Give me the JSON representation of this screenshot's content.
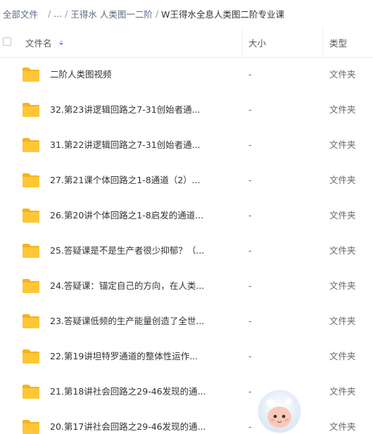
{
  "breadcrumb": {
    "root": "全部文件",
    "ellipsis": "...",
    "level2": "王得水 人类图一二阶",
    "current": "W王得水全息人类图二阶专业课",
    "separator": "/"
  },
  "table": {
    "columns": {
      "name": "文件名",
      "size": "大小",
      "type": "类型"
    },
    "rows": [
      {
        "name": "二阶人类图视频",
        "size": "-",
        "type": "文件夹",
        "icon": "folder-icon"
      },
      {
        "name": "32.第23讲逻辑回路之7-31创始者通...",
        "size": "-",
        "type": "文件夹",
        "icon": "folder-icon"
      },
      {
        "name": "31.第22讲逻辑回路之7-31创始者通...",
        "size": "-",
        "type": "文件夹",
        "icon": "folder-icon"
      },
      {
        "name": "27.第21课个体回路之1-8通道（2）...",
        "size": "-",
        "type": "文件夹",
        "icon": "folder-icon"
      },
      {
        "name": "26.第20讲个体回路之1-8启发的通道...",
        "size": "-",
        "type": "文件夹",
        "icon": "folder-icon"
      },
      {
        "name": "25.答疑课是不是生产者很少抑郁？（...",
        "size": "-",
        "type": "文件夹",
        "icon": "folder-icon"
      },
      {
        "name": "24.答疑课：锚定自己的方向，在人类...",
        "size": "-",
        "type": "文件夹",
        "icon": "folder-icon"
      },
      {
        "name": "23.答疑课低频的生产能量创造了全世...",
        "size": "-",
        "type": "文件夹",
        "icon": "folder-icon"
      },
      {
        "name": "22.第19讲坦特罗通道的整体性运作...",
        "size": "-",
        "type": "文件夹",
        "icon": "folder-icon"
      },
      {
        "name": "21.第18讲社会回路之29-46发现的通...",
        "size": "-",
        "type": "文件夹",
        "icon": "folder-icon"
      },
      {
        "name": "20.第17讲社会回路之29-46发现的通...",
        "size": "-",
        "type": "文件夹",
        "icon": "folder-icon"
      }
    ]
  },
  "colors": {
    "folder": "#ffc735",
    "link": "#5a6b85",
    "sort_active": "#3b8cff",
    "text": "#333333",
    "muted": "#666666"
  },
  "assistant": {
    "icon": "mascot-assistant-icon"
  }
}
